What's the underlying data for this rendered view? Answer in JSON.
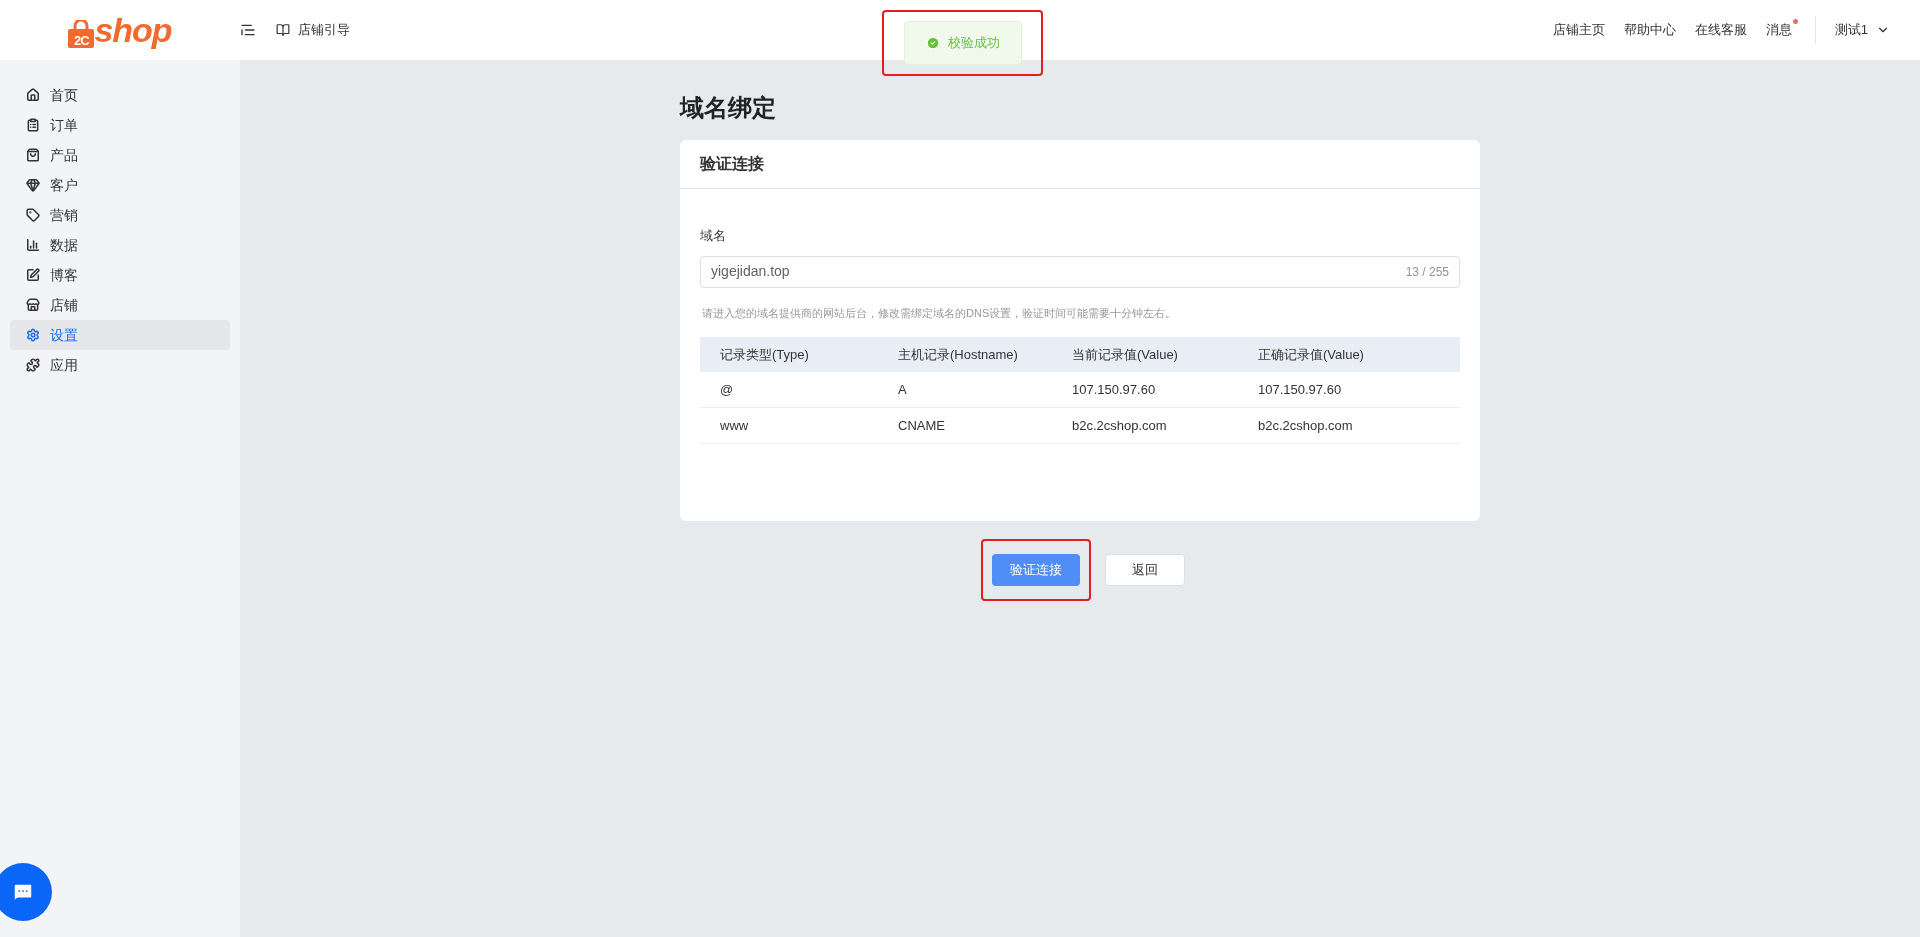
{
  "logo": {
    "mark": "2C",
    "text": "shop"
  },
  "header": {
    "guide": "店铺引导",
    "links": [
      "店铺主页",
      "帮助中心",
      "在线客服"
    ],
    "messages": {
      "label": "消息",
      "unread": true
    },
    "user": "测试1"
  },
  "toast": {
    "text": "校验成功"
  },
  "sidebar": {
    "items": [
      {
        "label": "首页",
        "selected": false
      },
      {
        "label": "订单",
        "selected": false
      },
      {
        "label": "产品",
        "selected": false
      },
      {
        "label": "客户",
        "selected": false
      },
      {
        "label": "营销",
        "selected": false
      },
      {
        "label": "数据",
        "selected": false
      },
      {
        "label": "博客",
        "selected": false
      },
      {
        "label": "店铺",
        "selected": false
      },
      {
        "label": "设置",
        "selected": true
      },
      {
        "label": "应用",
        "selected": false
      }
    ]
  },
  "page": {
    "title": "域名绑定",
    "card_title": "验证连接",
    "field": {
      "label": "域名",
      "value": "yigejidan.top",
      "counter": "13 / 255"
    },
    "hint": "请进入您的域名提供商的网站后台，修改需绑定域名的DNS设置，验证时间可能需要十分钟左右。",
    "table": {
      "columns": [
        "记录类型(Type)",
        "主机记录(Hostname)",
        "当前记录值(Value)",
        "正确记录值(Value)"
      ],
      "rows": [
        [
          "@",
          "A",
          "107.150.97.60",
          "107.150.97.60"
        ],
        [
          "www",
          "CNAME",
          "b2c.2cshop.com",
          "b2c.2cshop.com"
        ]
      ]
    },
    "buttons": {
      "primary": "验证连接",
      "secondary": "返回"
    }
  }
}
